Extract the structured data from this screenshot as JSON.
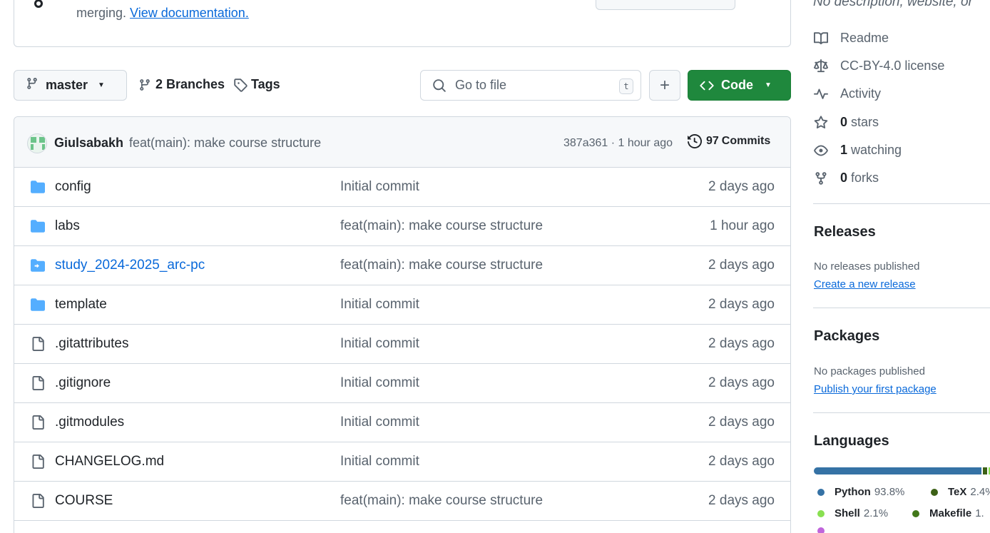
{
  "banner": {
    "text": "merging.",
    "link": "View documentation."
  },
  "toolbar": {
    "branch": "master",
    "branches_count": "2",
    "branches_label": "Branches",
    "tags_label": "Tags",
    "search_placeholder": "Go to file",
    "search_shortcut": "t",
    "add_label": "+",
    "code_label": "Code"
  },
  "latest_commit": {
    "author": "Giulsabakh",
    "message": "feat(main): make course structure",
    "meta": "387a361 · 1 hour ago",
    "commits_count": "97",
    "commits_label": "Commits"
  },
  "files": [
    {
      "name": "config",
      "type": "folder",
      "message": "Initial commit",
      "date": "2 days ago"
    },
    {
      "name": "labs",
      "type": "folder",
      "message": "feat(main): make course structure",
      "date": "1 hour ago"
    },
    {
      "name": "study_2024-2025_arc-pc",
      "type": "submodule",
      "message": "feat(main): make course structure",
      "date": "2 days ago"
    },
    {
      "name": "template",
      "type": "folder",
      "message": "Initial commit",
      "date": "2 days ago"
    },
    {
      "name": ".gitattributes",
      "type": "file",
      "message": "Initial commit",
      "date": "2 days ago"
    },
    {
      "name": ".gitignore",
      "type": "file",
      "message": "Initial commit",
      "date": "2 days ago"
    },
    {
      "name": ".gitmodules",
      "type": "file",
      "message": "Initial commit",
      "date": "2 days ago"
    },
    {
      "name": "CHANGELOG.md",
      "type": "file",
      "message": "Initial commit",
      "date": "2 days ago"
    },
    {
      "name": "COURSE",
      "type": "file",
      "message": "feat(main): make course structure",
      "date": "2 days ago"
    }
  ],
  "sidebar": {
    "description": "No description, website, or",
    "readme": "Readme",
    "license": "CC-BY-4.0 license",
    "activity": "Activity",
    "stars_count": "0",
    "stars_label": "stars",
    "watching_count": "1",
    "watching_label": "watching",
    "forks_count": "0",
    "forks_label": "forks",
    "releases_title": "Releases",
    "releases_empty": "No releases published",
    "releases_link": "Create a new release",
    "packages_title": "Packages",
    "packages_empty": "No packages published",
    "packages_link": "Publish your first package",
    "languages_title": "Languages",
    "languages": [
      {
        "name": "Python",
        "percent": "93.8%",
        "value": 93.8,
        "color": "#3572A5"
      },
      {
        "name": "TeX",
        "percent": "2.4%",
        "value": 2.4,
        "color": "#3D6117"
      },
      {
        "name": "Shell",
        "percent": "2.1%",
        "value": 2.1,
        "color": "#89e051"
      },
      {
        "name": "Makefile",
        "percent": "1.",
        "value": 1.6,
        "color": "#427819"
      },
      {
        "name": "",
        "percent": "",
        "value": 0.1,
        "color": "#c065db"
      }
    ]
  }
}
